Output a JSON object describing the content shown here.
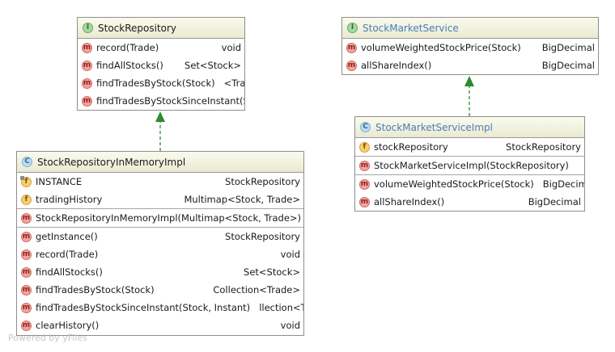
{
  "nodes": {
    "stock_repository": {
      "kind": "interface",
      "icon_letter": "I",
      "title": "StockRepository",
      "sections": [
        [
          {
            "icon": "method",
            "letter": "m",
            "name": "record(Trade)",
            "type": "void"
          },
          {
            "icon": "method",
            "letter": "m",
            "name": "findAllStocks()",
            "type": "Set<Stock>"
          },
          {
            "icon": "method",
            "letter": "m",
            "name": "findTradesByStock(Stock)",
            "type": "<Trade>"
          },
          {
            "icon": "method",
            "letter": "m",
            "name": "findTradesByStockSinceInstant(Stock",
            "type": ""
          }
        ]
      ]
    },
    "stock_market_service": {
      "kind": "interface",
      "icon_letter": "I",
      "title": "StockMarketService",
      "sections": [
        [
          {
            "icon": "method",
            "letter": "m",
            "name": "volumeWeightedStockPrice(Stock)",
            "type": "BigDecimal"
          },
          {
            "icon": "method",
            "letter": "m",
            "name": "allShareIndex()",
            "type": "BigDecimal"
          }
        ]
      ]
    },
    "stock_repository_in_memory_impl": {
      "kind": "class",
      "icon_letter": "C",
      "title": "StockRepositoryInMemoryImpl",
      "sections": [
        [
          {
            "icon": "field-static",
            "letter": "f",
            "name": "INSTANCE",
            "type": "StockRepository"
          },
          {
            "icon": "field",
            "letter": "f",
            "name": "tradingHistory",
            "type": "Multimap<Stock, Trade>"
          }
        ],
        [
          {
            "icon": "method",
            "letter": "m",
            "name": "StockRepositoryInMemoryImpl(Multimap<Stock, Trade>)",
            "type": ""
          }
        ],
        [
          {
            "icon": "method",
            "letter": "m",
            "name": "getInstance()",
            "type": "StockRepository"
          },
          {
            "icon": "method",
            "letter": "m",
            "name": "record(Trade)",
            "type": "void"
          },
          {
            "icon": "method",
            "letter": "m",
            "name": "findAllStocks()",
            "type": "Set<Stock>"
          },
          {
            "icon": "method",
            "letter": "m",
            "name": "findTradesByStock(Stock)",
            "type": "Collection<Trade>"
          },
          {
            "icon": "method",
            "letter": "m",
            "name": "findTradesByStockSinceInstant(Stock, Instant)",
            "type": "llection<Trade>"
          },
          {
            "icon": "method",
            "letter": "m",
            "name": "clearHistory()",
            "type": "void"
          }
        ]
      ]
    },
    "stock_market_service_impl": {
      "kind": "class",
      "icon_letter": "C",
      "title": "StockMarketServiceImpl",
      "sections": [
        [
          {
            "icon": "field",
            "letter": "f",
            "name": "stockRepository",
            "type": "StockRepository"
          }
        ],
        [
          {
            "icon": "method",
            "letter": "m",
            "name": "StockMarketServiceImpl(StockRepository)",
            "type": ""
          }
        ],
        [
          {
            "icon": "method",
            "letter": "m",
            "name": "volumeWeightedStockPrice(Stock)",
            "type": "BigDecimal"
          },
          {
            "icon": "method",
            "letter": "m",
            "name": "allShareIndex()",
            "type": "BigDecimal"
          }
        ]
      ]
    }
  },
  "edges": [
    {
      "from": "stock_repository_in_memory_impl",
      "to": "stock_repository",
      "relation": "implements"
    },
    {
      "from": "stock_market_service_impl",
      "to": "stock_market_service",
      "relation": "implements"
    }
  ],
  "colors": {
    "edge": "#2e8b2e",
    "header_top": "#fbfbee",
    "header_bottom": "#e9e9d2",
    "border": "#8e8e8e"
  },
  "watermark": "Powered by yFiles"
}
